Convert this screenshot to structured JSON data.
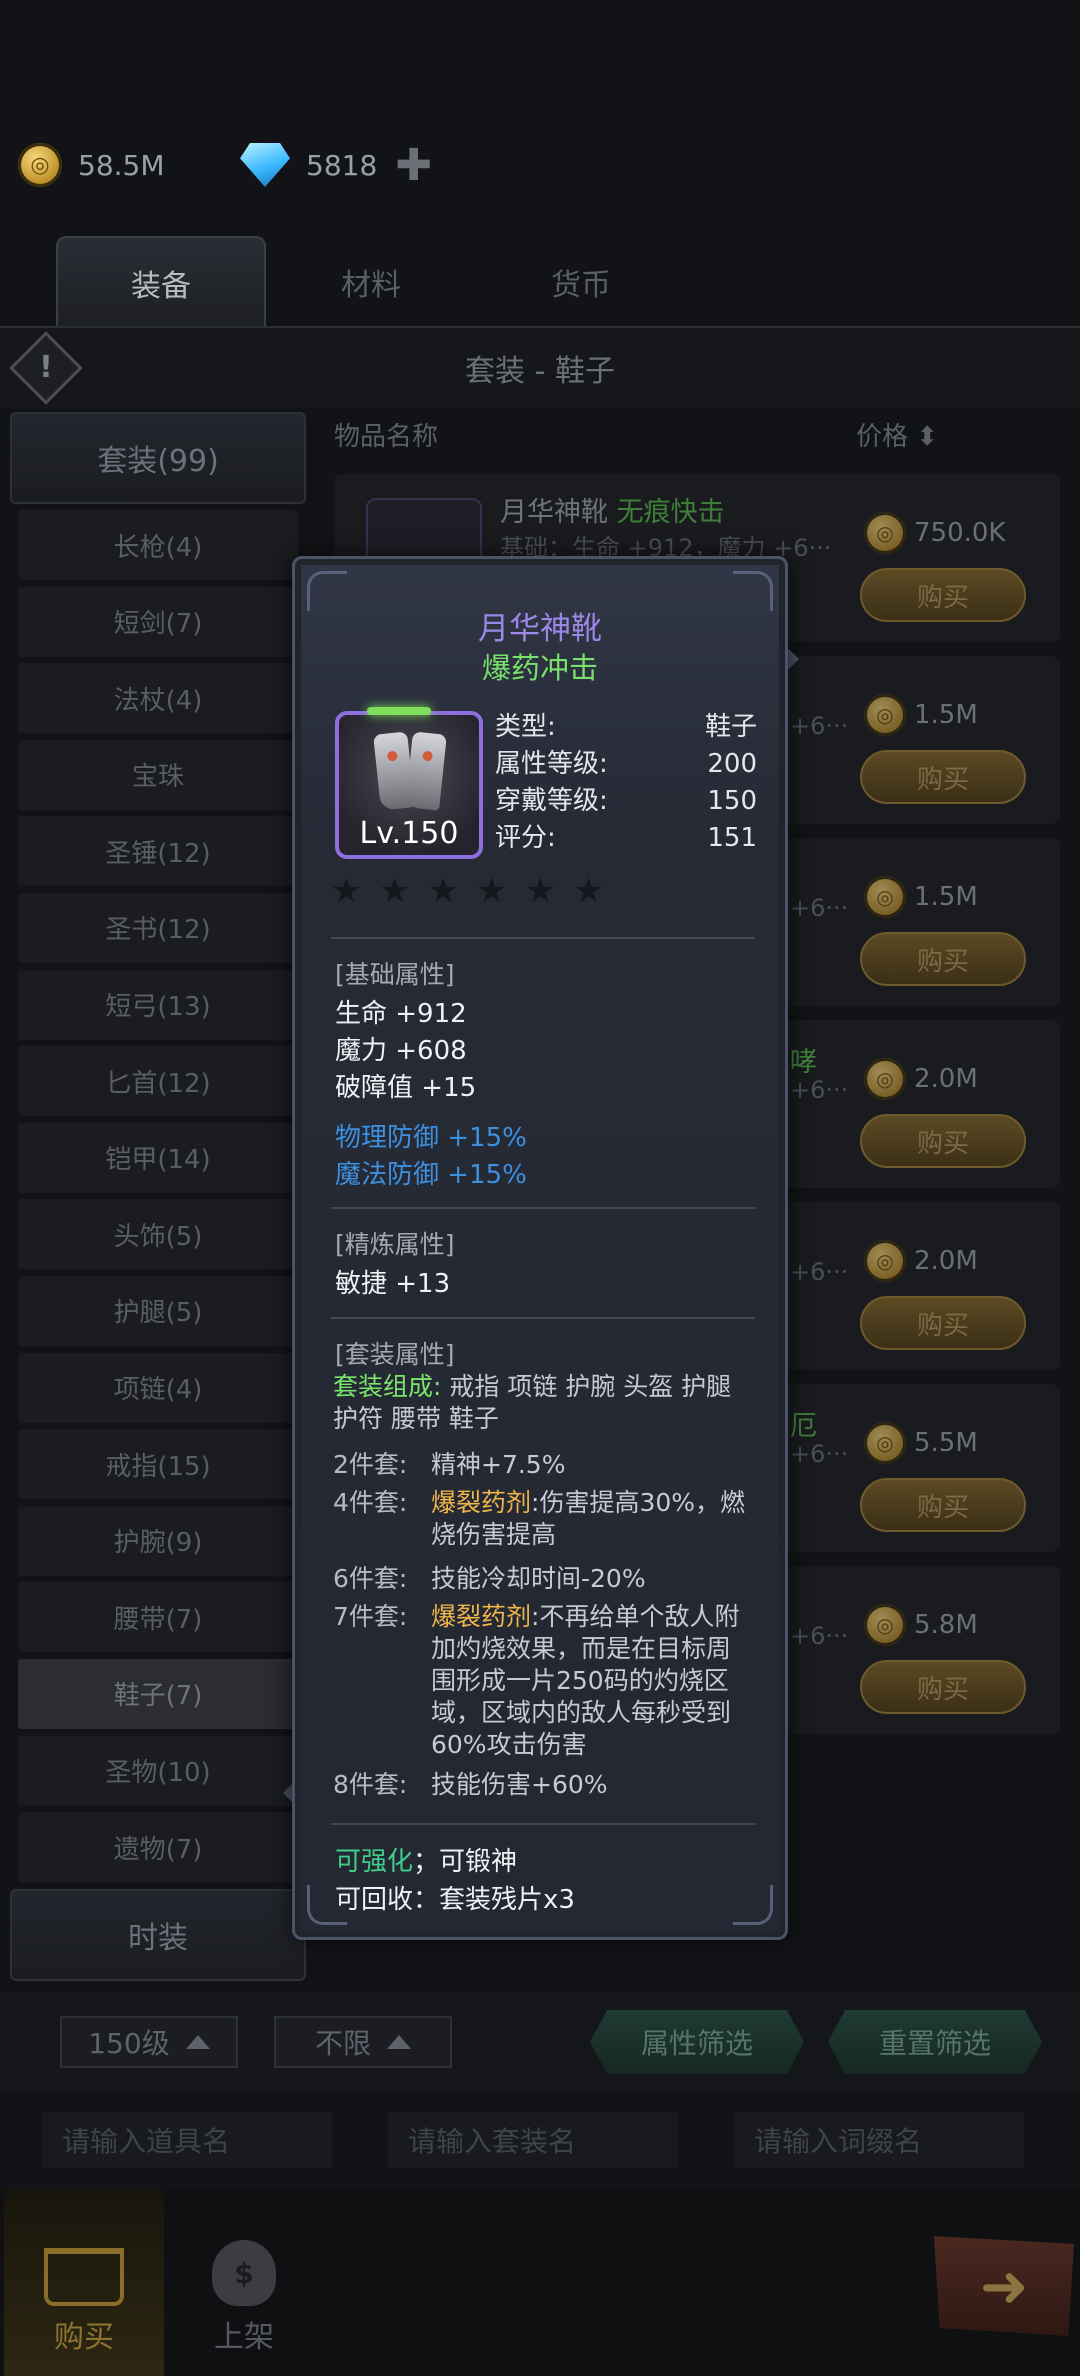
{
  "currency": {
    "gold": "58.5M",
    "gems": "5818"
  },
  "tabs": [
    {
      "label": "装备"
    },
    {
      "label": "材料"
    },
    {
      "label": "货币"
    }
  ],
  "page_title": "套装 - 鞋子",
  "sidebar": {
    "head": "套装(99)",
    "items": [
      {
        "label": "长枪(4)"
      },
      {
        "label": "短剑(7)"
      },
      {
        "label": "法杖(4)"
      },
      {
        "label": "宝珠"
      },
      {
        "label": "圣锤(12)"
      },
      {
        "label": "圣书(12)"
      },
      {
        "label": "短弓(13)"
      },
      {
        "label": "匕首(12)"
      },
      {
        "label": "铠甲(14)"
      },
      {
        "label": "头饰(5)"
      },
      {
        "label": "护腿(5)"
      },
      {
        "label": "项链(4)"
      },
      {
        "label": "戒指(15)"
      },
      {
        "label": "护腕(9)"
      },
      {
        "label": "腰带(7)"
      },
      {
        "label": "鞋子(7)"
      },
      {
        "label": "圣物(10)"
      },
      {
        "label": "遗物(7)"
      }
    ],
    "foot": "时装"
  },
  "list": {
    "col_name": "物品名称",
    "col_price": "价格",
    "rows": [
      {
        "name": "月华神靴",
        "tag": "无痕快击",
        "sub": "基础：生命 +912，魔力 +6···",
        "price": "750.0K",
        "buy": "购买"
      },
      {
        "sub": "+6···",
        "price": "1.5M",
        "buy": "购买"
      },
      {
        "sub": "+6···",
        "price": "1.5M",
        "buy": "购买"
      },
      {
        "extra": "哮",
        "sub": "+6···",
        "price": "2.0M",
        "buy": "购买"
      },
      {
        "sub": "+6···",
        "price": "2.0M",
        "buy": "购买"
      },
      {
        "extra": "厄",
        "sub": "+6···",
        "price": "5.5M",
        "buy": "购买"
      },
      {
        "sub": "+6···",
        "price": "5.8M",
        "buy": "购买"
      }
    ]
  },
  "filters": {
    "level": "150级",
    "limit": "不限",
    "attr_filter": "属性筛选",
    "reset_filter": "重置筛选",
    "search_item_placeholder": "请输入道具名",
    "search_set_placeholder": "请输入套装名",
    "search_affix_placeholder": "请输入词缀名"
  },
  "bottom_nav": {
    "buy": "购买",
    "sell": "上架",
    "bag_symbol": "$"
  },
  "tooltip": {
    "name": "月华神靴",
    "affix": "爆药冲击",
    "level_badge": "Lv.150",
    "stats": [
      {
        "k": "类型:",
        "v": "鞋子"
      },
      {
        "k": "属性等级:",
        "v": "200"
      },
      {
        "k": "穿戴等级:",
        "v": "150"
      },
      {
        "k": "评分:",
        "v": "151"
      }
    ],
    "stars_total": 6,
    "stars_filled": 0,
    "base_title": "[基础属性]",
    "base": [
      "生命 +912",
      "魔力 +608",
      "破障值 +15"
    ],
    "base_blue": [
      "物理防御 +15%",
      "魔法防御 +15%"
    ],
    "refine_title": "[精炼属性]",
    "refine": [
      "敏捷 +13"
    ],
    "set_title": "[套装属性]",
    "set_comp_label": "套装组成:",
    "set_comp": "戒指 项链 护腕 头盔 护腿 护符 腰带 鞋子",
    "set_bonus": [
      {
        "lbl": "2件套:",
        "text": "精神+7.5%"
      },
      {
        "lbl": "4件套:",
        "key": "爆裂药剂",
        "text": ":伤害提高30%，燃烧伤害提高"
      },
      {
        "lbl": "6件套:",
        "text": "技能冷却时间-20%"
      },
      {
        "lbl": "7件套:",
        "key": "爆裂药剂",
        "text": ":不再给单个敌人附加灼烧效果，而是在目标周围形成一片250码的灼烧区域，区域内的敌人每秒受到60%攻击伤害"
      },
      {
        "lbl": "8件套:",
        "text": "技能伤害+60%"
      }
    ],
    "upgrade_key": "可强化",
    "upgrade_rest": "；可锻神",
    "recycle": "可回收：套装残片x3"
  },
  "colors": {
    "rarity_purple": "#9b87e6",
    "affix_green": "#78e06b",
    "set_gold": "#f1b64a",
    "stat_blue": "#3d8fe0"
  }
}
